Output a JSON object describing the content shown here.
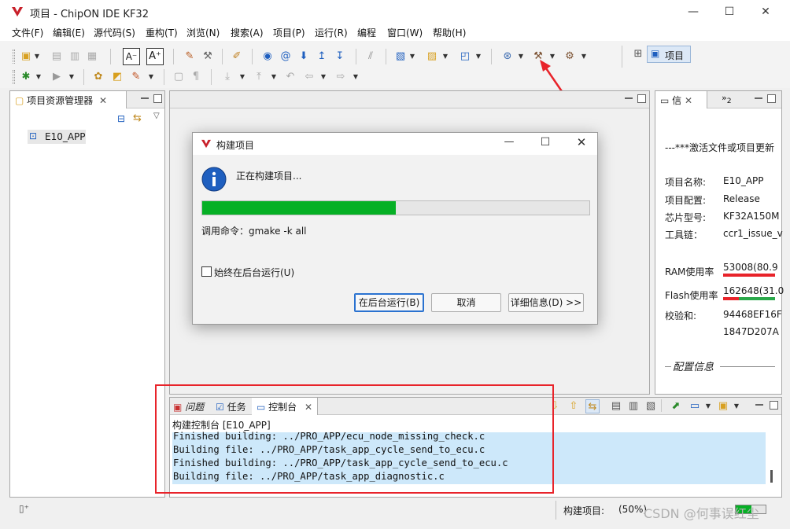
{
  "window": {
    "title": "项目 - ChipON IDE KF32",
    "controls": {
      "minimize": "—",
      "maximize": "☐",
      "close": "✕"
    }
  },
  "menubar": {
    "items": [
      "文件(F)",
      "编辑(E)",
      "源代码(S)",
      "重构(T)",
      "浏览(N)",
      "搜索(A)",
      "项目(P)",
      "运行(R)",
      "编程",
      "窗口(W)",
      "帮助(H)"
    ]
  },
  "toolbar": {
    "perspective_label": "项目",
    "icons": [
      "new-file-icon",
      "save-icon",
      "save-all-icon",
      "print-icon",
      "font-decrease-icon",
      "font-increase-icon",
      "edit-icon",
      "wrench-icon",
      "brush-icon",
      "search-icon",
      "at-icon",
      "arrow-down-icon",
      "arrow-up-icon",
      "arrow-return-icon",
      "format-icon",
      "new-project-icon",
      "new-folder-icon",
      "new-class-icon",
      "debug-icon",
      "build-hammer-icon",
      "build-all-icon",
      "bug-icon",
      "run-icon",
      "open-icon",
      "folder-icon",
      "tool-icon"
    ]
  },
  "project_explorer": {
    "title": "项目资源管理器",
    "tree": [
      {
        "label": "E10_APP"
      }
    ]
  },
  "info_panel": {
    "tab_label": "信",
    "overflow_label": "2",
    "header": "---***激活文件或项目更新",
    "rows": [
      {
        "key": "项目名称:",
        "value": "E10_APP"
      },
      {
        "key": "项目配置:",
        "value": "Release"
      },
      {
        "key": "芯片型号:",
        "value": "KF32A150M"
      },
      {
        "key": "工具链：",
        "value": "ccr1_issue_v"
      }
    ],
    "ram": {
      "key": "RAM使用率",
      "value": "53008(80.9"
    },
    "flash": {
      "key": "Flash使用率",
      "value": "162648(31.0"
    },
    "checksum": {
      "key": "校验和:",
      "value1": "94468EF16F",
      "value2": "1847D207A"
    },
    "config_label": "配置信息"
  },
  "dialog": {
    "title": "构建项目",
    "message": "正在构建项目...",
    "progress": 0.5,
    "command_label": "调用命令：gmake -k all",
    "checkbox_label": "始终在后台运行(U)",
    "checkbox_checked": false,
    "buttons": {
      "background": "在后台运行(B)",
      "cancel": "取消",
      "details": "详细信息(D) >>"
    }
  },
  "bottom_panel": {
    "tabs": [
      "问题",
      "任务",
      "控制台"
    ],
    "active_tab": "控制台",
    "console_title": "构建控制台 [E10_APP]",
    "lines": [
      "Finished building: ../PRO_APP/ecu_node_missing_check.c",
      "Building file: ../PRO_APP/task_app_cycle_send_to_ecu.c",
      "Finished building: ../PRO_APP/task_app_cycle_send_to_ecu.c",
      "Building file: ../PRO_APP/task_app_diagnostic.c"
    ]
  },
  "status": {
    "build_label": "构建项目:",
    "build_percent": "(50%)",
    "watermark": "CSDN @何事误红尘"
  },
  "colors": {
    "progress_fill": "#06b025",
    "annotation_red": "#e8232a",
    "console_highlight": "#cde8fa",
    "accent_blue": "#1f5fbf"
  }
}
